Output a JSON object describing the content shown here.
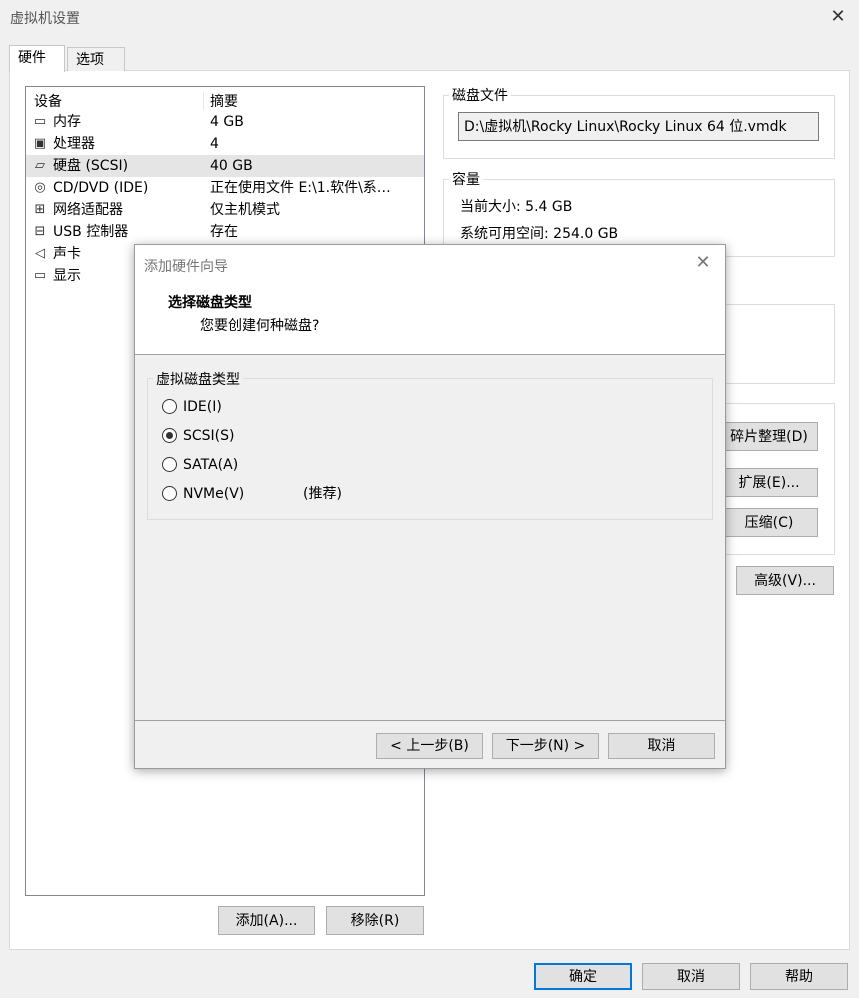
{
  "window": {
    "title": "虚拟机设置",
    "close_glyph": "✕"
  },
  "tabs": [
    {
      "label": "硬件",
      "active": true
    },
    {
      "label": "选项",
      "active": false
    }
  ],
  "device_list": {
    "col_device": "设备",
    "col_summary": "摘要",
    "items": [
      {
        "icon": "memory-icon",
        "glyph": "▭",
        "name": "内存",
        "summary": "4 GB",
        "selected": false
      },
      {
        "icon": "cpu-icon",
        "glyph": "▣",
        "name": "处理器",
        "summary": "4",
        "selected": false
      },
      {
        "icon": "harddisk-icon",
        "glyph": "▱",
        "name": "硬盘 (SCSI)",
        "summary": "40 GB",
        "selected": true
      },
      {
        "icon": "cdrom-icon",
        "glyph": "◎",
        "name": "CD/DVD (IDE)",
        "summary": "正在使用文件 E:\\1.软件\\系…",
        "selected": false
      },
      {
        "icon": "network-icon",
        "glyph": "⊞",
        "name": "网络适配器",
        "summary": "仅主机模式",
        "selected": false
      },
      {
        "icon": "usb-icon",
        "glyph": "⊟",
        "name": "USB 控制器",
        "summary": "存在",
        "selected": false
      },
      {
        "icon": "sound-icon",
        "glyph": "◁",
        "name": "声卡",
        "summary": "",
        "selected": false
      },
      {
        "icon": "display-icon",
        "glyph": "▭",
        "name": "显示",
        "summary": "",
        "selected": false
      }
    ]
  },
  "disk_file": {
    "label": "磁盘文件",
    "path": "D:\\虚拟机\\Rocky Linux\\Rocky Linux 64 位.vmdk"
  },
  "capacity": {
    "label": "容量",
    "current_size": "当前大小: 5.4 GB",
    "free_space": "系统可用空间: 254.0 GB"
  },
  "disk_buttons": {
    "defragment": "碎片整理(D)",
    "expand": "扩展(E)...",
    "compact": "压缩(C)",
    "advanced": "高级(V)..."
  },
  "list_buttons": {
    "add": "添加(A)...",
    "remove": "移除(R)"
  },
  "footer_buttons": {
    "ok": "确定",
    "cancel": "取消",
    "help": "帮助"
  },
  "dialog": {
    "title": "添加硬件向导",
    "close_glyph": "✕",
    "heading": "选择磁盘类型",
    "subheading": "您要创建何种磁盘?",
    "group_label": "虚拟磁盘类型",
    "options": [
      {
        "label": "IDE(I)",
        "selected": false,
        "note": ""
      },
      {
        "label": "SCSI(S)",
        "selected": true,
        "note": ""
      },
      {
        "label": "SATA(A)",
        "selected": false,
        "note": ""
      },
      {
        "label": "NVMe(V)",
        "selected": false,
        "note": "(推荐)"
      }
    ],
    "back": "< 上一步(B)",
    "next": "下一步(N) >",
    "cancel": "取消"
  }
}
